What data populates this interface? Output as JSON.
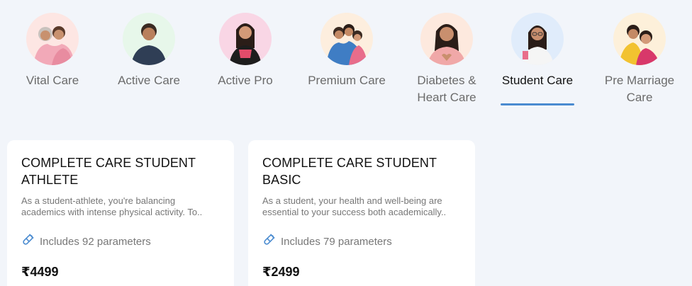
{
  "tabs": [
    {
      "label": "Vital Care",
      "bg": "#fde6e3",
      "active": false
    },
    {
      "label": "Active Care",
      "bg": "#e7f7ea",
      "active": false
    },
    {
      "label": "Active Pro",
      "bg": "#f9d6e5",
      "active": false
    },
    {
      "label": "Premium Care",
      "bg": "#fdeede",
      "active": false
    },
    {
      "label": "Diabetes &\nHeart Care",
      "bg": "#fde9de",
      "active": false
    },
    {
      "label": "Student Care",
      "bg": "#e0ecfb",
      "active": true
    },
    {
      "label": "Pre Marriage\nCare",
      "bg": "#fdf0da",
      "active": false
    }
  ],
  "cards": [
    {
      "title": "COMPLETE CARE STUDENT ATHLETE",
      "description": "As a student-athlete, you're balancing academics with intense physical activity. To..",
      "parameters": "Includes 92 parameters",
      "price": "₹4499"
    },
    {
      "title": "COMPLETE CARE STUDENT BASIC",
      "description": "As a student, your health and well-being are essential to your success both academically..",
      "parameters": "Includes 79 parameters",
      "price": "₹2499"
    }
  ],
  "colors": {
    "accent": "#4a8bd0",
    "background": "#f2f5fa"
  },
  "icons": {
    "parameter": "test-tube-icon"
  }
}
